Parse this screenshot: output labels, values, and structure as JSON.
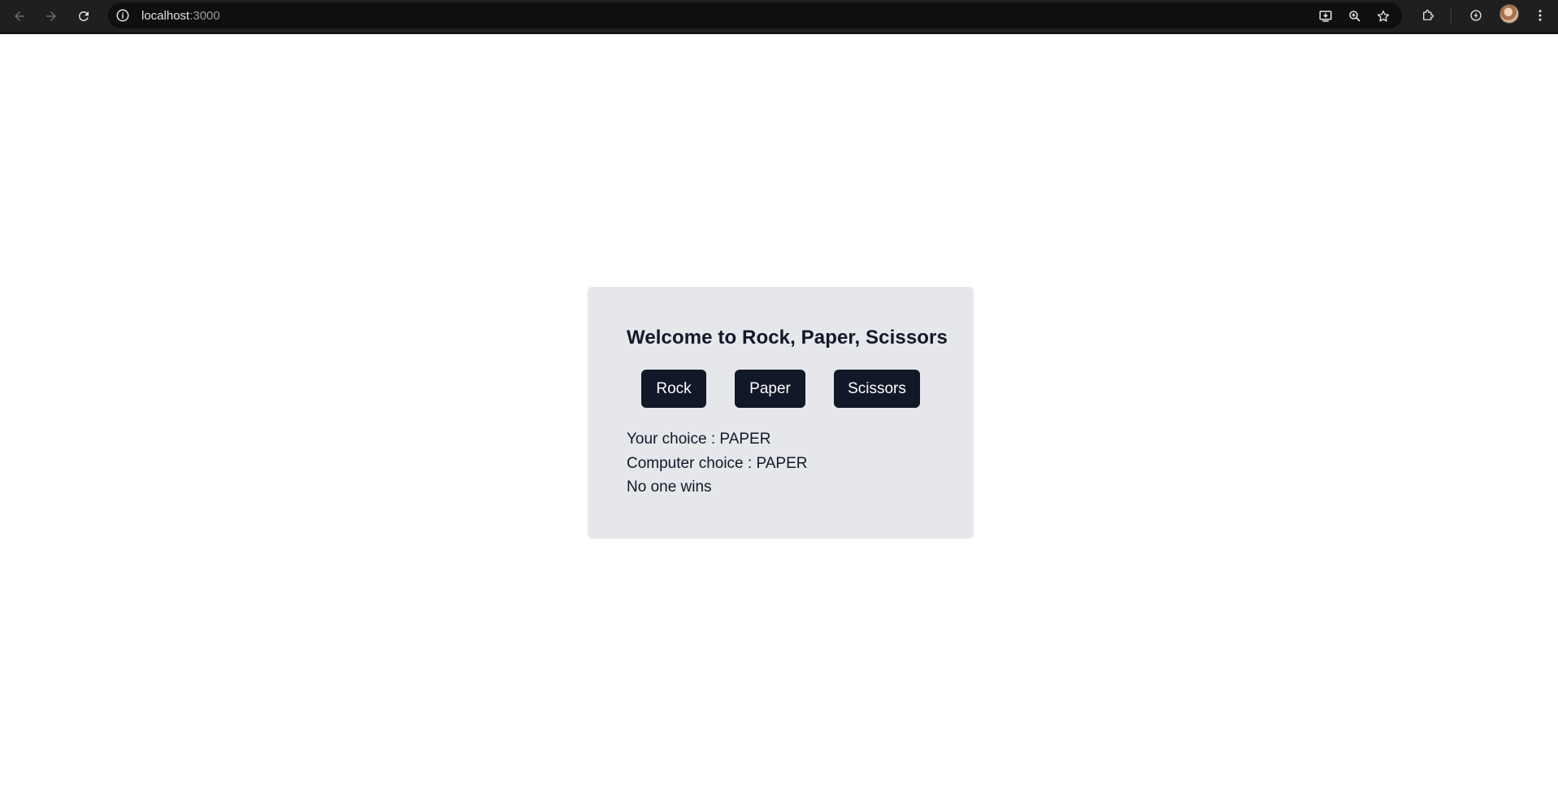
{
  "browser": {
    "url_host": "localhost",
    "url_port": ":3000"
  },
  "game": {
    "title": "Welcome to Rock, Paper, Scissors",
    "buttons": {
      "rock": "Rock",
      "paper": "Paper",
      "scissors": "Scissors"
    },
    "your_choice": "Your choice : PAPER",
    "computer_choice": "Computer choice : PAPER",
    "outcome": "No one wins"
  },
  "colors": {
    "card_background": "#e5e7eb",
    "button_background": "#111827",
    "text": "#111827",
    "chrome_background": "#1f1f1f"
  },
  "icons": [
    "back-arrow-icon",
    "forward-arrow-icon",
    "reload-icon",
    "info-icon",
    "install-icon",
    "zoom-icon",
    "star-icon",
    "extensions-icon",
    "performance-icon",
    "avatar",
    "menu-icon"
  ]
}
